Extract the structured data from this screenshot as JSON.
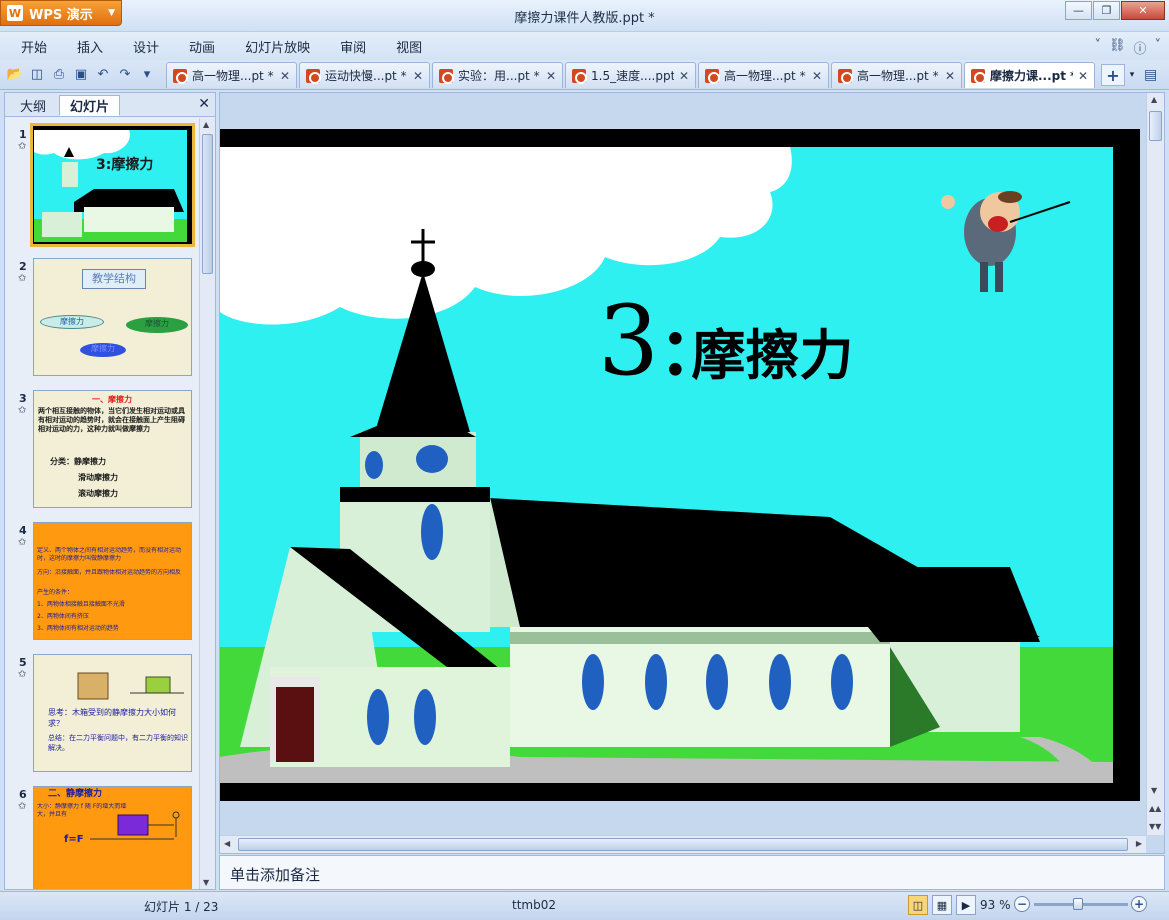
{
  "app": {
    "brand_label": "WPS 演示",
    "window_title": "摩擦力课件人教版.ppt *"
  },
  "menu": {
    "items": [
      "开始",
      "插入",
      "设计",
      "动画",
      "幻灯片放映",
      "审阅",
      "视图"
    ]
  },
  "doc_tabs": [
    {
      "label": "高一物理...pt *",
      "active": false
    },
    {
      "label": "运动快慢...pt *",
      "active": false
    },
    {
      "label": "实验：用...pt *",
      "active": false
    },
    {
      "label": "1.5_速度....ppt *",
      "active": false
    },
    {
      "label": "高一物理...pt *",
      "active": false
    },
    {
      "label": "高一物理...pt *",
      "active": false
    },
    {
      "label": "摩擦力课...pt *",
      "active": true
    }
  ],
  "panel": {
    "tab_outline": "大纲",
    "tab_slides": "幻灯片"
  },
  "thumbnails": [
    {
      "number": "1",
      "texts": [
        "3:摩擦力"
      ]
    },
    {
      "number": "2",
      "texts": [
        "教学结构",
        "摩擦力",
        "摩擦力",
        "摩擦力"
      ]
    },
    {
      "number": "3",
      "texts": [
        "一、摩擦力",
        "两个相互接触的物体，当它们发生相对运动或具有相对运动的趋势时，就会在接触面上产生阻碍相对运动的力，这种力就叫做摩擦力",
        "分类：静摩擦力",
        "滑动摩擦力",
        "滚动摩擦力"
      ]
    },
    {
      "number": "4",
      "texts": [
        "定义、两个物体之间有相对运动趋势，而没有相对运动时，这时的摩擦力叫做静摩擦力",
        "方向：沿接触面，并且跟物体相对运动趋势的方向相反",
        "产生的条件：",
        "1、两物体相接触且接触面不光滑",
        "2、两物体间有挤压",
        "3、两物体间有相对运动的趋势"
      ]
    },
    {
      "number": "5",
      "texts": [
        "思考：木箱受到的静摩擦力大小如何求？",
        "总结：在二力平衡问题中，有二力平衡的知识解决。"
      ]
    },
    {
      "number": "6",
      "texts": [
        "二、静摩擦力",
        "大小：静摩擦力 f 随 F的增大而增大，并且有",
        "f=F"
      ]
    }
  ],
  "slide": {
    "title_number": "3:",
    "title_text": "摩擦力"
  },
  "notes": {
    "placeholder": "单击添加备注"
  },
  "status": {
    "slide_indicator": "幻灯片 1 / 23",
    "theme_name": "ttmb02",
    "zoom_label": "93 %",
    "zoom_value": 93
  },
  "colors": {
    "slide_sky": "#2ef0f0",
    "slide_grass": "#44d93a",
    "accent_orange": "#ff9a10",
    "selection": "#e6b93a"
  },
  "icons": [
    "wps-logo-icon",
    "open-icon",
    "save-icon",
    "print-icon",
    "preview-icon",
    "undo-icon",
    "redo-icon",
    "ppt-file-icon",
    "close-icon",
    "add-tab-icon",
    "shirt-icon",
    "help-icon"
  ]
}
